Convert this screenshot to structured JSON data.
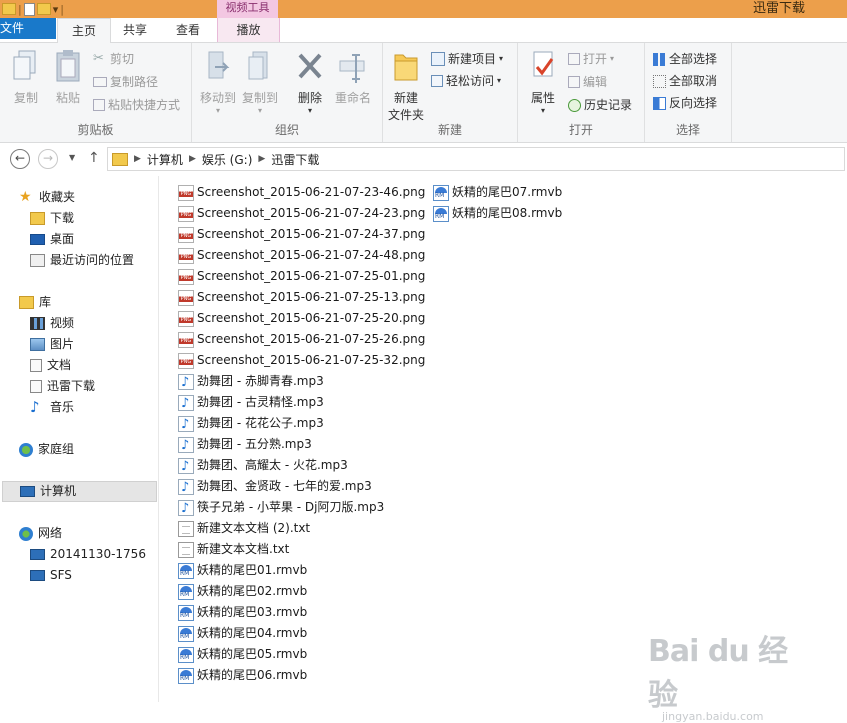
{
  "window": {
    "title": "迅雷下载"
  },
  "ribbon_tabs": {
    "file": "文件",
    "home": "主页",
    "share": "共享",
    "view": "查看",
    "context_group": "视频工具",
    "play": "播放"
  },
  "clipboard": {
    "copy": "复制",
    "paste": "粘贴",
    "cut": "剪切",
    "copy_path": "复制路径",
    "paste_shortcut": "粘贴快捷方式",
    "group": "剪贴板"
  },
  "organize": {
    "move_to": "移动到",
    "copy_to": "复制到",
    "delete": "删除",
    "rename": "重命名",
    "group": "组织"
  },
  "new_group": {
    "new_folder_line1": "新建",
    "new_folder_line2": "文件夹",
    "new_item": "新建项目",
    "easy_access": "轻松访问",
    "group": "新建"
  },
  "open_group": {
    "properties": "属性",
    "open": "打开",
    "edit": "编辑",
    "history": "历史记录",
    "group": "打开"
  },
  "select_group": {
    "select_all": "全部选择",
    "select_none": "全部取消",
    "invert": "反向选择",
    "group": "选择"
  },
  "address": {
    "crumbs": [
      "计算机",
      "娱乐 (G:)",
      "迅雷下载"
    ]
  },
  "nav": {
    "favorites": "收藏夹",
    "downloads": "下载",
    "desktop": "桌面",
    "recent": "最近访问的位置",
    "libraries": "库",
    "videos": "视频",
    "pictures": "图片",
    "documents": "文档",
    "xunlei": "迅雷下载",
    "music": "音乐",
    "homegroup": "家庭组",
    "computer": "计算机",
    "network": "网络",
    "net1": "20141130-1756",
    "net2": "SFS"
  },
  "files": {
    "col1": [
      "Screenshot_2015-06-21-07-23-46.png",
      "Screenshot_2015-06-21-07-24-23.png",
      "Screenshot_2015-06-21-07-24-37.png",
      "Screenshot_2015-06-21-07-24-48.png",
      "Screenshot_2015-06-21-07-25-01.png",
      "Screenshot_2015-06-21-07-25-13.png",
      "Screenshot_2015-06-21-07-25-20.png",
      "Screenshot_2015-06-21-07-25-26.png",
      "Screenshot_2015-06-21-07-25-32.png",
      "劲舞团 - 赤脚青春.mp3",
      "劲舞团 - 古灵精怪.mp3",
      "劲舞团 - 花花公子.mp3",
      "劲舞团 - 五分熟.mp3",
      "劲舞团、高耀太 - 火花.mp3",
      "劲舞团、金贤政 - 七年的爱.mp3",
      "筷子兄弟 - 小苹果 - Dj阿刀版.mp3",
      "新建文本文档 (2).txt",
      "新建文本文档.txt",
      "妖精的尾巴01.rmvb",
      "妖精的尾巴02.rmvb",
      "妖精的尾巴03.rmvb",
      "妖精的尾巴04.rmvb",
      "妖精的尾巴05.rmvb",
      "妖精的尾巴06.rmvb"
    ],
    "col2": [
      "妖精的尾巴07.rmvb",
      "妖精的尾巴08.rmvb"
    ]
  },
  "watermark": {
    "logo": "Bai du 经验",
    "sub": "jingyan.baidu.com"
  }
}
